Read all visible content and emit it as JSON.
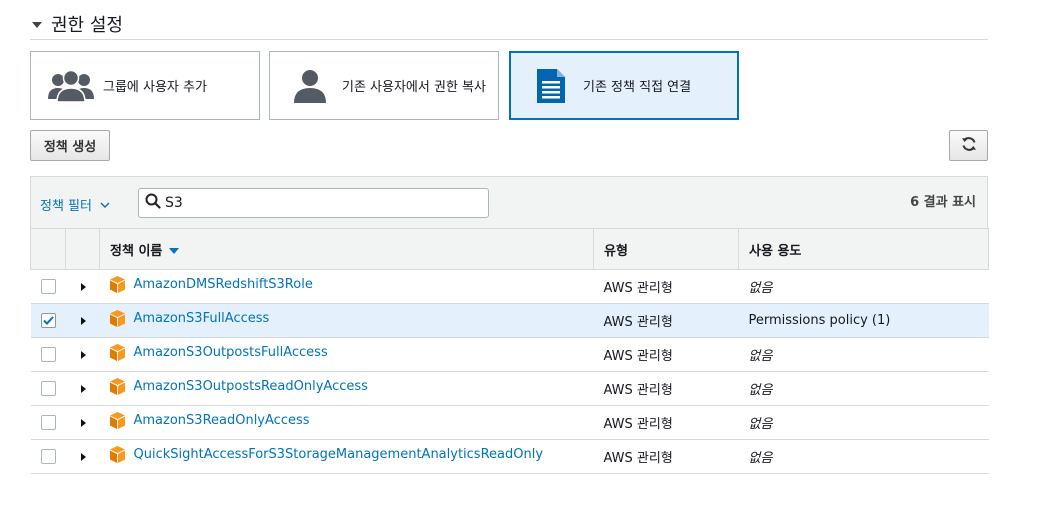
{
  "section": {
    "title": "권한 설정"
  },
  "options": [
    {
      "label": "그룹에 사용자 추가",
      "icon": "users-group-icon",
      "selected": false
    },
    {
      "label": "기존 사용자에서 권한 복사",
      "icon": "user-icon",
      "selected": false
    },
    {
      "label": "기존 정책 직접 연결",
      "icon": "document-icon",
      "selected": true
    }
  ],
  "toolbar": {
    "create_policy_label": "정책 생성",
    "refresh_icon": "refresh-icon"
  },
  "filter": {
    "toggle_label": "정책 필터",
    "search_value": "S3",
    "result_count": "6 결과 표시"
  },
  "table": {
    "headers": {
      "name": "정책 이름",
      "type": "유형",
      "usage": "사용 용도"
    },
    "rows": [
      {
        "name": "AmazonDMSRedshiftS3Role",
        "type": "AWS 관리형",
        "usage": "없음",
        "checked": false
      },
      {
        "name": "AmazonS3FullAccess",
        "type": "AWS 관리형",
        "usage": "Permissions policy (1)",
        "checked": true
      },
      {
        "name": "AmazonS3OutpostsFullAccess",
        "type": "AWS 관리형",
        "usage": "없음",
        "checked": false
      },
      {
        "name": "AmazonS3OutpostsReadOnlyAccess",
        "type": "AWS 관리형",
        "usage": "없음",
        "checked": false
      },
      {
        "name": "AmazonS3ReadOnlyAccess",
        "type": "AWS 관리형",
        "usage": "없음",
        "checked": false
      },
      {
        "name": "QuickSightAccessForS3StorageManagementAnalyticsReadOnly",
        "type": "AWS 관리형",
        "usage": "없음",
        "checked": false
      }
    ]
  },
  "colors": {
    "accent": "#0073bb",
    "selected_bg": "#e4f0fb",
    "policy_icon": "#f7981f"
  }
}
